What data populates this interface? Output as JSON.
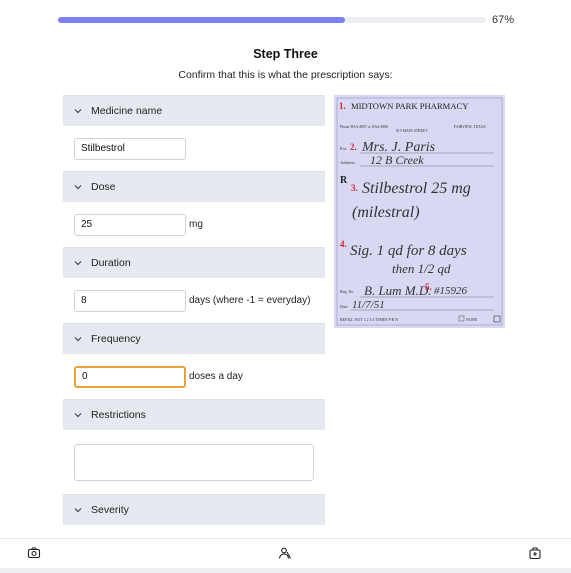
{
  "progress": {
    "value": 0.67,
    "label": "67%"
  },
  "step": {
    "title": "Step Three",
    "subtitle": "Confirm that this is what the prescription says:"
  },
  "sections": {
    "medicine": {
      "header": "Medicine name",
      "value": "Stilbestrol"
    },
    "dose": {
      "header": "Dose",
      "value": "25",
      "unit": "mg"
    },
    "duration": {
      "header": "Duration",
      "value": "8",
      "unit": "days (where -1 = everyday)"
    },
    "frequency": {
      "header": "Frequency",
      "value": "0",
      "unit": "doses a day"
    },
    "restrictions": {
      "header": "Restrictions",
      "value": ""
    },
    "severity": {
      "header": "Severity"
    }
  },
  "prescription": {
    "pharmacy": "MIDTOWN PARK PHARMACY",
    "phone": "Phone DA4-4907 or DA4-4906",
    "address": "915 MAIN STREET",
    "city": "FAIRVIEW, TEXAS",
    "for_label": "For",
    "patient": "Mrs. J. Paris",
    "address_label": "Address",
    "patient_address": "12 B Creek",
    "rx_symbol": "R",
    "drug_line1": "Stilbestrol 25 mg",
    "drug_line2": "(milestral)",
    "sig_line1": "Sig. 1 qd for 8 days",
    "sig_line2": "then 1/2 qd",
    "reg_label": "Reg. No.",
    "doctor": "B. Lum M.D.",
    "number": "#15926",
    "date_label": "Date",
    "date": "11/7/51",
    "refill": "REFILL NOT  1  2  3  4  TIMES  P  R  N",
    "none": "NONE",
    "markers": [
      "1.",
      "2.",
      "3.",
      "4.",
      "5."
    ]
  },
  "colors": {
    "accent": "#7b7ff0",
    "focus": "#e7a23a",
    "section_bg": "#e6e9ef",
    "rx_bg": "#d9d8f3",
    "marker": "#d4202a"
  },
  "icons": {
    "collapse": "chevron-down-icon",
    "camera": "camera-icon",
    "person": "person-icon",
    "medicine": "medicine-bag-icon"
  }
}
